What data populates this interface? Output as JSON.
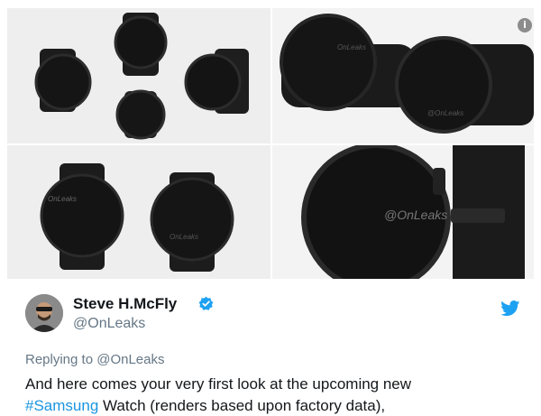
{
  "media": {
    "watermark": "@OnLeaks",
    "watermark_small": "OnLeaks"
  },
  "author": {
    "display_name": "Steve H.McFly",
    "handle": "@OnLeaks",
    "verified": true
  },
  "reply": {
    "text": "Replying to @OnLeaks"
  },
  "tweet": {
    "line1": "And here comes your very first look at the upcoming new",
    "hashtag": "#Samsung",
    "line2_rest": " Watch (renders based upon factory data),"
  },
  "colors": {
    "twitter_blue": "#1da1f2",
    "link_blue": "#1b95e0",
    "secondary_text": "#657786"
  },
  "icons": [
    "info-icon",
    "verified-badge-icon",
    "twitter-bird-icon"
  ]
}
